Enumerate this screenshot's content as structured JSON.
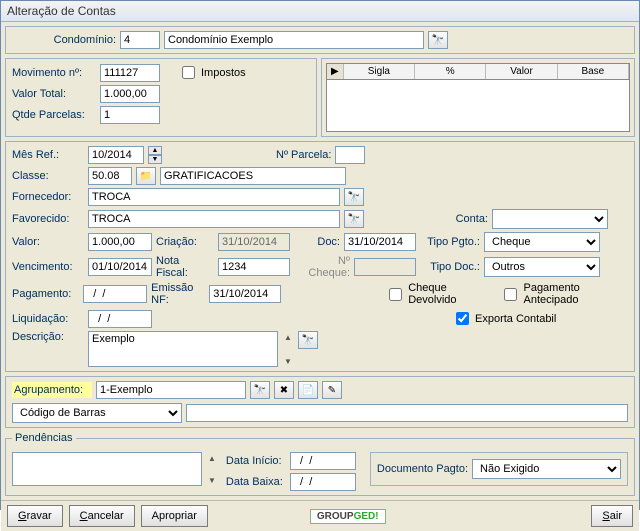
{
  "window": {
    "title": "Alteração de Contas"
  },
  "condo": {
    "label": "Condomínio:",
    "code": "4",
    "name": "Condomínio Exemplo"
  },
  "mov": {
    "num_label": "Movimento nº:",
    "num": "111127",
    "valor_total_label": "Valor Total:",
    "valor_total": "1.000,00",
    "qtde_label": "Qtde Parcelas:",
    "qtde": "1",
    "impostos_label": "Impostos"
  },
  "grid": {
    "h1": "Sigla",
    "h2": "%",
    "h3": "Valor",
    "h4": "Base"
  },
  "form": {
    "mes_label": "Mês Ref.:",
    "mes": "10/2014",
    "parcela_label": "Nº Parcela:",
    "parcela": "",
    "classe_label": "Classe:",
    "classe": "50.08",
    "classe_desc": "GRATIFICACOES",
    "forn_label": "Fornecedor:",
    "forn": "TROCA",
    "fav_label": "Favorecido:",
    "fav": "TROCA",
    "conta_label": "Conta:",
    "conta": "",
    "valor_label": "Valor:",
    "valor": "1.000,00",
    "criacao_label": "Criação:",
    "criacao": "31/10/2014",
    "doc_label": "Doc:",
    "doc": "31/10/2014",
    "tipopgto_label": "Tipo Pgto.:",
    "tipopgto": "Cheque",
    "venc_label": "Vencimento:",
    "venc": "01/10/2014",
    "nf_label": "Nota Fiscal:",
    "nf": "1234",
    "cheque_label": "Nº Cheque:",
    "cheque": "",
    "tipodoc_label": "Tipo Doc.:",
    "tipodoc": "Outros",
    "pag_label": "Pagamento:",
    "pag": "  /  /",
    "emnf_label": "Emissão NF:",
    "emnf": "31/10/2014",
    "cheque_dev_label": "Cheque Devolvido",
    "pag_antec_label": "Pagamento Antecipado",
    "liq_label": "Liquidação:",
    "liq": "  /  /",
    "exporta_label": "Exporta Contabil",
    "desc_label": "Descrição:",
    "desc": "Exemplo"
  },
  "agr": {
    "label": "Agrupamento:",
    "value": "1-Exemplo",
    "barcode_label": "Código de Barras",
    "barcode_value": ""
  },
  "pend": {
    "legend": "Pendências",
    "inicio_label": "Data Início:",
    "inicio": "  /  /",
    "baixa_label": "Data Baixa:",
    "baixa": "  /  /",
    "docpgto_label": "Documento Pagto:",
    "docpgto": "Não Exigido"
  },
  "footer": {
    "gravar": "Gravar",
    "cancelar": "Cancelar",
    "apropriar": "Apropriar",
    "group": "GROUP",
    "ged": "GED!",
    "sair": "Sair"
  }
}
